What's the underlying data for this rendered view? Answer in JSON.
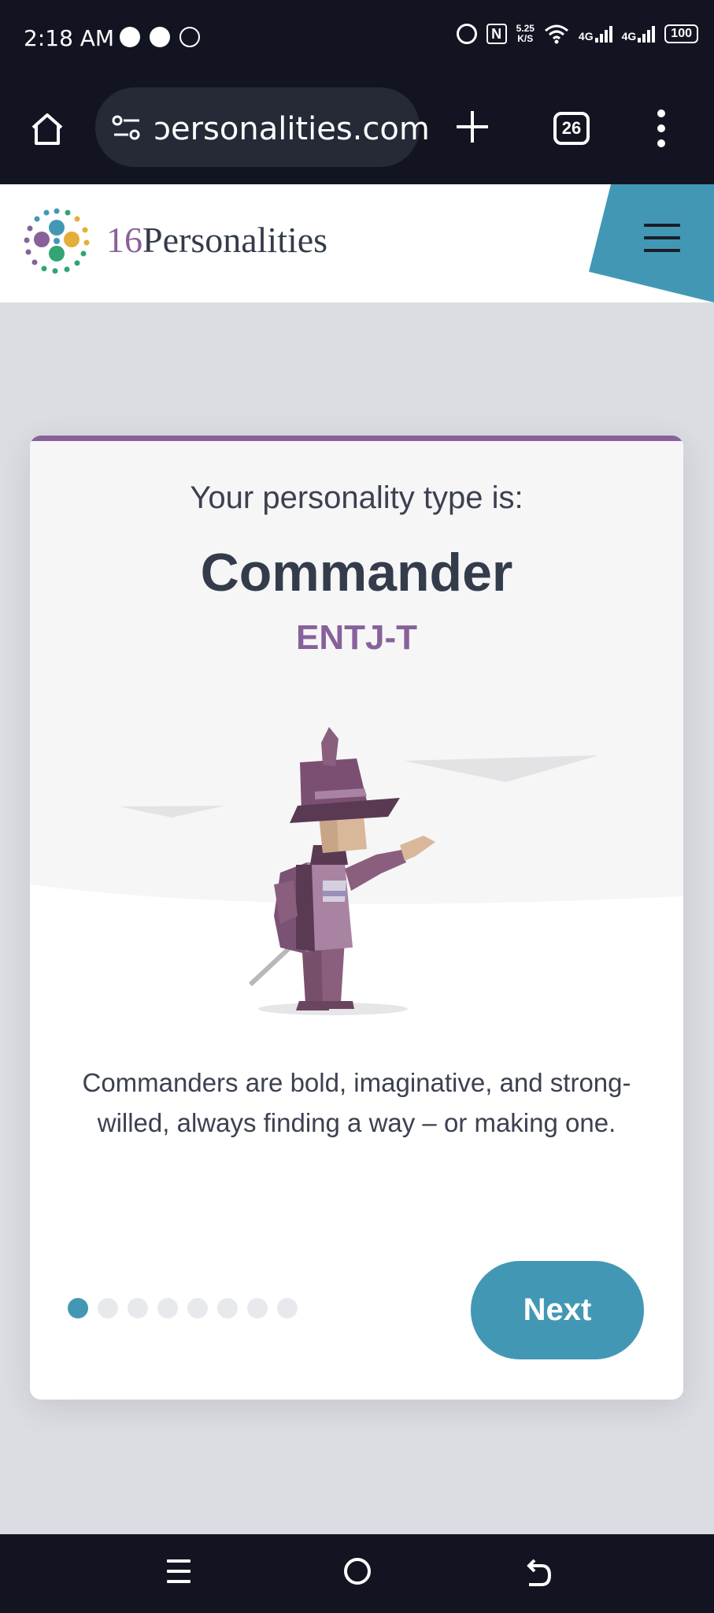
{
  "status_bar": {
    "time": "2:18 AM",
    "notification_icons": [
      "messenger-icon",
      "chat-icon",
      "facebook-icon"
    ],
    "net_speed": "5.25",
    "net_speed_unit": "K/S",
    "network_1": "4G",
    "network_2": "4G",
    "battery": "100"
  },
  "browser": {
    "url_display": "ɔersonalities.com",
    "tab_count": "26"
  },
  "site": {
    "logo_number": "16",
    "logo_word": "Personalities"
  },
  "card": {
    "intro": "Your personality type is:",
    "type_name": "Commander",
    "type_code": "ENTJ-T",
    "description": "Commanders are bold, imaginative, and strong-willed, always finding a way – or making one.",
    "pagination_total": 8,
    "pagination_current": 1,
    "next_label": "Next"
  },
  "colors": {
    "accent_blue": "#4298b4",
    "accent_purple": "#88619a",
    "text_dark": "#343c4b",
    "system_bar": "#121521"
  }
}
